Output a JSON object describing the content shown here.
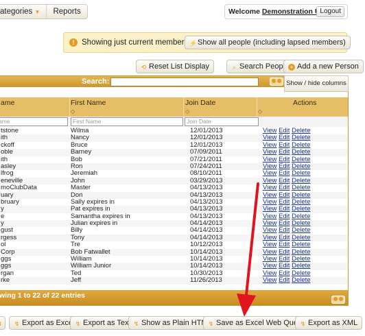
{
  "nav": {
    "categories": "ategories",
    "reports": "Reports"
  },
  "welcome": {
    "prefix": "Welcome",
    "user": "Demonstration User",
    "logout": "Logout"
  },
  "notice": {
    "text": "Showing just current members.",
    "button": "Show all people (including lapsed members)"
  },
  "toolbar": {
    "reset": "Reset List Display",
    "search_people": "Search People",
    "add_person": "Add a new Person"
  },
  "table": {
    "search_label": "Search:",
    "show_hide": "Show / hide columns",
    "columns": {
      "last": "ame",
      "first": "First Name",
      "join": "Join Date",
      "actions": "Actions"
    },
    "filter_placeholders": {
      "last": "ame",
      "first": "First Name",
      "join": "Join Date"
    },
    "action_labels": {
      "view": "View",
      "edit": "Edit",
      "delete": "Delete"
    },
    "rows": [
      [
        "tstone",
        "Wilma",
        "12/01/2013"
      ],
      [
        "ith",
        "Nancy",
        "12/01/2013"
      ],
      [
        "ckoff",
        "Bruce",
        "12/01/2013"
      ],
      [
        "oble",
        "Barney",
        "07/09/2011"
      ],
      [
        "ith",
        "Bob",
        "07/21/2011"
      ],
      [
        "asley",
        "Ron",
        "07/24/2011"
      ],
      [
        "lfrog",
        "Jeremiah",
        "08/10/2011"
      ],
      [
        "eneville",
        "John",
        "03/29/2013"
      ],
      [
        "moClubData",
        "Master",
        "04/13/2013"
      ],
      [
        "uary",
        "Don",
        "04/13/2013"
      ],
      [
        "bruary",
        "Sally expires in",
        "04/13/2013"
      ],
      [
        "y",
        "Pat expires in",
        "04/13/2013"
      ],
      [
        "e",
        "Samantha expires in",
        "04/13/2013"
      ],
      [
        "y",
        "Julian expires in",
        "04/14/2013"
      ],
      [
        "gust",
        "Billy",
        "04/14/2013"
      ],
      [
        "rgess",
        "Tony",
        "04/14/2013"
      ],
      [
        "ol",
        "Tre",
        "10/12/2013"
      ],
      [
        "Corp",
        "Bob Fatwallet",
        "10/14/2013"
      ],
      [
        "ggs",
        "William",
        "10/14/2013"
      ],
      [
        "ggs",
        "William Junior",
        "10/14/2013"
      ],
      [
        "rgan",
        "Ted",
        "10/30/2013"
      ],
      [
        "rke",
        "Jeff",
        "11/26/2013"
      ]
    ],
    "footer_info": "wing 1 to 22 of 22 entries"
  },
  "exports": {
    "excel": "Export as Excel",
    "text": "Export as Text",
    "html": "Show as Plain HTML",
    "web_query": "Save as Excel Web Query",
    "xml": "Export as XML"
  },
  "colors": {
    "accent": "#e69a1c",
    "header": "#d6a23b",
    "arrow": "#e0141e",
    "link": "#16358e"
  }
}
